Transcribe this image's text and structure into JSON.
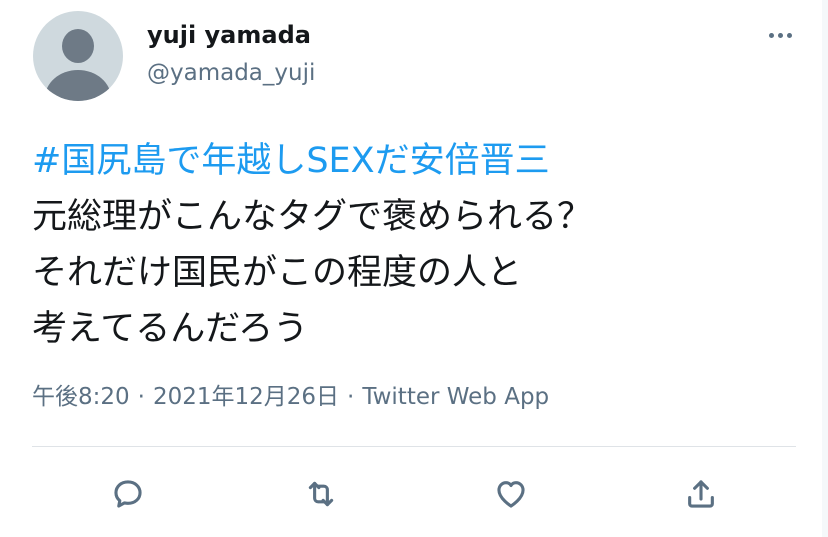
{
  "author": {
    "display_name": "yuji yamada",
    "handle": "@yamada_yuji",
    "avatar": "default-profile-avatar"
  },
  "more_icon": "more-horizontal-icon",
  "tweet": {
    "hashtag": "#国尻島で年越しSEXだ安倍晋三",
    "lines": [
      "元総理がこんなタグで褒められる？",
      "それだけ国民がこの程度の人と",
      "考えてるんだろう"
    ]
  },
  "meta": {
    "time": "午後8:20",
    "date": "2021年12月26日",
    "source": "Twitter Web App",
    "separator": "·"
  },
  "actions": [
    {
      "name": "reply",
      "icon": "comment-bubble-icon"
    },
    {
      "name": "retweet",
      "icon": "retweet-arrows-icon"
    },
    {
      "name": "like",
      "icon": "heart-icon"
    },
    {
      "name": "share",
      "icon": "share-upload-icon"
    }
  ],
  "colors": {
    "text_primary": "#14171a",
    "text_secondary": "#5b7083",
    "hashtag": "#1d9bf0",
    "divider": "#dfe3e7",
    "avatar_bg": "#cfd9de"
  }
}
